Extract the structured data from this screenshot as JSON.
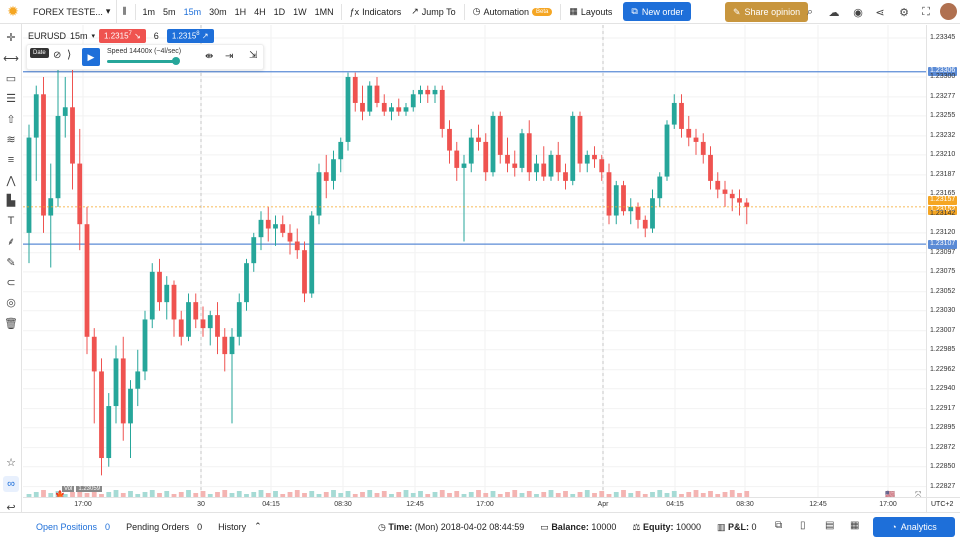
{
  "topbar": {
    "account": "FOREX TESTE...",
    "timeframes": [
      "1m",
      "5m",
      "15m",
      "30m",
      "1H",
      "4H",
      "1D",
      "1W",
      "1MN"
    ],
    "active_timeframe": "15m",
    "indicators_label": "Indicators",
    "jump_label": "Jump To",
    "automation_label": "Automation",
    "beta_label": "Beta",
    "layouts_label": "Layouts",
    "new_order_label": "New order",
    "share_label": "Share opinion"
  },
  "legend": {
    "symbol": "EURUSD",
    "timeframe": "15m",
    "sell_price": "1.2315",
    "sell_suffix": "7",
    "spread": "6",
    "buy_price": "1.2315",
    "buy_suffix": "8"
  },
  "replay": {
    "date_badge": "Date",
    "speed_label": "Speed 14400x (~4l/sec)"
  },
  "price_scale": {
    "labels": [
      "1.23345",
      "1.23300",
      "1.23277",
      "1.23255",
      "1.23232",
      "1.23210",
      "1.23187",
      "1.23165",
      "1.23142",
      "1.23120",
      "1.23097",
      "1.23075",
      "1.23052",
      "1.23030",
      "1.23007",
      "1.22985",
      "1.22962",
      "1.22940",
      "1.22917",
      "1.22895",
      "1.22872",
      "1.22850",
      "1.22827"
    ],
    "upper_line_tag": "1.23306",
    "lower_line_tag": "1.23107",
    "current_tag": "1.23157",
    "current_tag_b": "1.23152"
  },
  "time_axis": {
    "labels": [
      "17:00",
      "30",
      "04:15",
      "08:30",
      "12:45",
      "17:00",
      "Apr",
      "04:15",
      "08:30",
      "12:45",
      "17:00"
    ],
    "timezone": "UTC+2"
  },
  "volume_badge": {
    "label": "Vol",
    "value": "1.23059"
  },
  "bottombar": {
    "open_positions_label": "Open Positions",
    "open_positions_count": "0",
    "pending_orders_label": "Pending Orders",
    "pending_orders_count": "0",
    "history_label": "History",
    "time_label": "Time:",
    "time_value": "(Mon) 2018-04-02 08:44:59",
    "balance_label": "Balance:",
    "balance_value": "10000",
    "equity_label": "Equity:",
    "equity_value": "10000",
    "pl_label": "P&L:",
    "pl_value": "0",
    "analytics_label": "Analytics"
  },
  "colors": {
    "bull": "#26a69a",
    "bear": "#ef5350",
    "accent": "#1e6fd9",
    "hline": "#5b8bd6"
  },
  "chart_data": {
    "type": "candlestick",
    "symbol": "EURUSD",
    "timeframe": "15m",
    "ylim": [
      1.22815,
      1.2336
    ],
    "horizontal_lines": [
      1.23306,
      1.23107
    ],
    "candles": [
      {
        "o": 1.2312,
        "h": 1.23245,
        "l": 1.23085,
        "c": 1.2323
      },
      {
        "o": 1.2323,
        "h": 1.2329,
        "l": 1.2318,
        "c": 1.2328
      },
      {
        "o": 1.2328,
        "h": 1.233,
        "l": 1.2312,
        "c": 1.2314
      },
      {
        "o": 1.2314,
        "h": 1.232,
        "l": 1.2308,
        "c": 1.2316
      },
      {
        "o": 1.2316,
        "h": 1.2333,
        "l": 1.2315,
        "c": 1.23255
      },
      {
        "o": 1.23255,
        "h": 1.233,
        "l": 1.2323,
        "c": 1.23265
      },
      {
        "o": 1.23265,
        "h": 1.2332,
        "l": 1.2317,
        "c": 1.232
      },
      {
        "o": 1.232,
        "h": 1.2324,
        "l": 1.231,
        "c": 1.2313
      },
      {
        "o": 1.2313,
        "h": 1.2315,
        "l": 1.2298,
        "c": 1.23
      },
      {
        "o": 1.23,
        "h": 1.2301,
        "l": 1.229,
        "c": 1.2296
      },
      {
        "o": 1.2296,
        "h": 1.22975,
        "l": 1.2284,
        "c": 1.2286
      },
      {
        "o": 1.2286,
        "h": 1.22935,
        "l": 1.2285,
        "c": 1.2292
      },
      {
        "o": 1.2292,
        "h": 1.2299,
        "l": 1.229,
        "c": 1.22975
      },
      {
        "o": 1.22975,
        "h": 1.23,
        "l": 1.2288,
        "c": 1.229
      },
      {
        "o": 1.229,
        "h": 1.2295,
        "l": 1.2286,
        "c": 1.2294
      },
      {
        "o": 1.2294,
        "h": 1.22985,
        "l": 1.2292,
        "c": 1.2296
      },
      {
        "o": 1.2296,
        "h": 1.2303,
        "l": 1.2295,
        "c": 1.2302
      },
      {
        "o": 1.2302,
        "h": 1.23085,
        "l": 1.2301,
        "c": 1.23075
      },
      {
        "o": 1.23075,
        "h": 1.2309,
        "l": 1.2303,
        "c": 1.2304
      },
      {
        "o": 1.2304,
        "h": 1.2307,
        "l": 1.2302,
        "c": 1.2306
      },
      {
        "o": 1.2306,
        "h": 1.23065,
        "l": 1.23,
        "c": 1.2302
      },
      {
        "o": 1.2302,
        "h": 1.2303,
        "l": 1.2299,
        "c": 1.23
      },
      {
        "o": 1.23,
        "h": 1.2305,
        "l": 1.22995,
        "c": 1.2304
      },
      {
        "o": 1.2304,
        "h": 1.2305,
        "l": 1.2301,
        "c": 1.2302
      },
      {
        "o": 1.2302,
        "h": 1.23035,
        "l": 1.23,
        "c": 1.2301
      },
      {
        "o": 1.2301,
        "h": 1.2303,
        "l": 1.2299,
        "c": 1.23025
      },
      {
        "o": 1.23025,
        "h": 1.2304,
        "l": 1.2298,
        "c": 1.23
      },
      {
        "o": 1.23,
        "h": 1.2301,
        "l": 1.2296,
        "c": 1.2298
      },
      {
        "o": 1.2298,
        "h": 1.2301,
        "l": 1.229,
        "c": 1.23
      },
      {
        "o": 1.23,
        "h": 1.2305,
        "l": 1.2299,
        "c": 1.2304
      },
      {
        "o": 1.2304,
        "h": 1.2309,
        "l": 1.2303,
        "c": 1.23085
      },
      {
        "o": 1.23085,
        "h": 1.2312,
        "l": 1.23075,
        "c": 1.23115
      },
      {
        "o": 1.23115,
        "h": 1.23145,
        "l": 1.231,
        "c": 1.23135
      },
      {
        "o": 1.23135,
        "h": 1.2315,
        "l": 1.2311,
        "c": 1.23125
      },
      {
        "o": 1.23125,
        "h": 1.2314,
        "l": 1.23105,
        "c": 1.2313
      },
      {
        "o": 1.2313,
        "h": 1.2314,
        "l": 1.23115,
        "c": 1.2312
      },
      {
        "o": 1.2312,
        "h": 1.2313,
        "l": 1.23095,
        "c": 1.2311
      },
      {
        "o": 1.2311,
        "h": 1.23125,
        "l": 1.2309,
        "c": 1.231
      },
      {
        "o": 1.231,
        "h": 1.2311,
        "l": 1.2304,
        "c": 1.2305
      },
      {
        "o": 1.2305,
        "h": 1.23145,
        "l": 1.23045,
        "c": 1.2314
      },
      {
        "o": 1.2314,
        "h": 1.232,
        "l": 1.2313,
        "c": 1.2319
      },
      {
        "o": 1.2319,
        "h": 1.2321,
        "l": 1.2316,
        "c": 1.2318
      },
      {
        "o": 1.2318,
        "h": 1.23215,
        "l": 1.2317,
        "c": 1.23205
      },
      {
        "o": 1.23205,
        "h": 1.2323,
        "l": 1.2319,
        "c": 1.23225
      },
      {
        "o": 1.23225,
        "h": 1.23305,
        "l": 1.23215,
        "c": 1.233
      },
      {
        "o": 1.233,
        "h": 1.23305,
        "l": 1.2326,
        "c": 1.2327
      },
      {
        "o": 1.2327,
        "h": 1.2329,
        "l": 1.2325,
        "c": 1.2326
      },
      {
        "o": 1.2326,
        "h": 1.23295,
        "l": 1.23255,
        "c": 1.2329
      },
      {
        "o": 1.2329,
        "h": 1.233,
        "l": 1.23265,
        "c": 1.2327
      },
      {
        "o": 1.2327,
        "h": 1.2328,
        "l": 1.23255,
        "c": 1.2326
      },
      {
        "o": 1.2326,
        "h": 1.2327,
        "l": 1.2325,
        "c": 1.23265
      },
      {
        "o": 1.23265,
        "h": 1.23275,
        "l": 1.23255,
        "c": 1.2326
      },
      {
        "o": 1.2326,
        "h": 1.2327,
        "l": 1.23255,
        "c": 1.23265
      },
      {
        "o": 1.23265,
        "h": 1.23285,
        "l": 1.2326,
        "c": 1.2328
      },
      {
        "o": 1.2328,
        "h": 1.2329,
        "l": 1.2327,
        "c": 1.23285
      },
      {
        "o": 1.23285,
        "h": 1.2329,
        "l": 1.2327,
        "c": 1.2328
      },
      {
        "o": 1.2328,
        "h": 1.2329,
        "l": 1.2327,
        "c": 1.23285
      },
      {
        "o": 1.23285,
        "h": 1.2329,
        "l": 1.2323,
        "c": 1.2324
      },
      {
        "o": 1.2324,
        "h": 1.2325,
        "l": 1.232,
        "c": 1.23215
      },
      {
        "o": 1.23215,
        "h": 1.23225,
        "l": 1.2318,
        "c": 1.23195
      },
      {
        "o": 1.23195,
        "h": 1.2321,
        "l": 1.2311,
        "c": 1.232
      },
      {
        "o": 1.232,
        "h": 1.2324,
        "l": 1.2319,
        "c": 1.2323
      },
      {
        "o": 1.2323,
        "h": 1.23245,
        "l": 1.23215,
        "c": 1.23225
      },
      {
        "o": 1.23225,
        "h": 1.23235,
        "l": 1.2318,
        "c": 1.2319
      },
      {
        "o": 1.2319,
        "h": 1.2326,
        "l": 1.23185,
        "c": 1.23255
      },
      {
        "o": 1.23255,
        "h": 1.2326,
        "l": 1.232,
        "c": 1.2321
      },
      {
        "o": 1.2321,
        "h": 1.2323,
        "l": 1.2319,
        "c": 1.232
      },
      {
        "o": 1.232,
        "h": 1.23215,
        "l": 1.23185,
        "c": 1.23195
      },
      {
        "o": 1.23195,
        "h": 1.2324,
        "l": 1.2319,
        "c": 1.23235
      },
      {
        "o": 1.23235,
        "h": 1.2325,
        "l": 1.2318,
        "c": 1.2319
      },
      {
        "o": 1.2319,
        "h": 1.2321,
        "l": 1.2318,
        "c": 1.232
      },
      {
        "o": 1.232,
        "h": 1.2322,
        "l": 1.2318,
        "c": 1.23185
      },
      {
        "o": 1.23185,
        "h": 1.23215,
        "l": 1.2318,
        "c": 1.2321
      },
      {
        "o": 1.2321,
        "h": 1.23225,
        "l": 1.2318,
        "c": 1.2319
      },
      {
        "o": 1.2319,
        "h": 1.232,
        "l": 1.2317,
        "c": 1.2318
      },
      {
        "o": 1.2318,
        "h": 1.2326,
        "l": 1.23175,
        "c": 1.23255
      },
      {
        "o": 1.23255,
        "h": 1.2326,
        "l": 1.2319,
        "c": 1.232
      },
      {
        "o": 1.232,
        "h": 1.23215,
        "l": 1.2319,
        "c": 1.2321
      },
      {
        "o": 1.2321,
        "h": 1.2322,
        "l": 1.23195,
        "c": 1.23205
      },
      {
        "o": 1.23205,
        "h": 1.2321,
        "l": 1.2318,
        "c": 1.2319
      },
      {
        "o": 1.2319,
        "h": 1.232,
        "l": 1.2313,
        "c": 1.2314
      },
      {
        "o": 1.2314,
        "h": 1.2318,
        "l": 1.2313,
        "c": 1.23175
      },
      {
        "o": 1.23175,
        "h": 1.2318,
        "l": 1.2314,
        "c": 1.23145
      },
      {
        "o": 1.23145,
        "h": 1.2316,
        "l": 1.2313,
        "c": 1.2315
      },
      {
        "o": 1.2315,
        "h": 1.23155,
        "l": 1.23125,
        "c": 1.23135
      },
      {
        "o": 1.23135,
        "h": 1.2314,
        "l": 1.23115,
        "c": 1.23125
      },
      {
        "o": 1.23125,
        "h": 1.2317,
        "l": 1.2312,
        "c": 1.2316
      },
      {
        "o": 1.2316,
        "h": 1.2319,
        "l": 1.2315,
        "c": 1.23185
      },
      {
        "o": 1.23185,
        "h": 1.2325,
        "l": 1.2318,
        "c": 1.23245
      },
      {
        "o": 1.23245,
        "h": 1.2328,
        "l": 1.2324,
        "c": 1.2327
      },
      {
        "o": 1.2327,
        "h": 1.2328,
        "l": 1.2323,
        "c": 1.2324
      },
      {
        "o": 1.2324,
        "h": 1.23255,
        "l": 1.2322,
        "c": 1.2323
      },
      {
        "o": 1.2323,
        "h": 1.2324,
        "l": 1.2321,
        "c": 1.23225
      },
      {
        "o": 1.23225,
        "h": 1.23235,
        "l": 1.232,
        "c": 1.2321
      },
      {
        "o": 1.2321,
        "h": 1.2322,
        "l": 1.2317,
        "c": 1.2318
      },
      {
        "o": 1.2318,
        "h": 1.2319,
        "l": 1.2316,
        "c": 1.2317
      },
      {
        "o": 1.2317,
        "h": 1.2318,
        "l": 1.2315,
        "c": 1.23165
      },
      {
        "o": 1.23165,
        "h": 1.2317,
        "l": 1.23145,
        "c": 1.2316
      },
      {
        "o": 1.2316,
        "h": 1.2317,
        "l": 1.2314,
        "c": 1.23155
      },
      {
        "o": 1.23155,
        "h": 1.2316,
        "l": 1.2313,
        "c": 1.2315
      }
    ]
  }
}
